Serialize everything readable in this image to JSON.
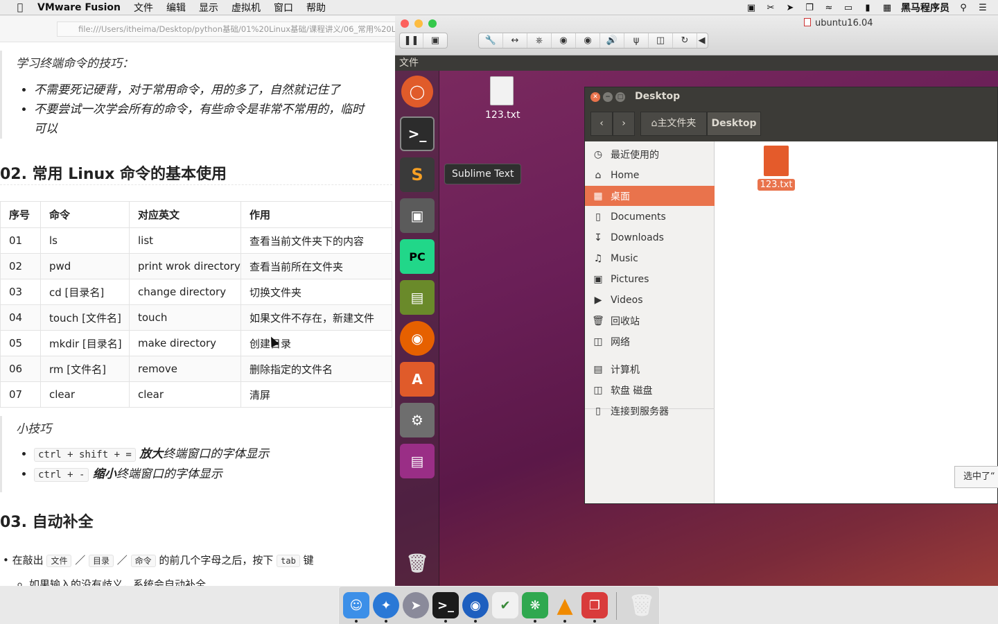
{
  "menubar": {
    "app": "VMware Fusion",
    "items": [
      "文件",
      "编辑",
      "显示",
      "虚拟机",
      "窗口",
      "帮助"
    ],
    "right_user": "黑马程序员"
  },
  "doc": {
    "url": "file:///Users/itheima/Desktop/python基础/01%20Linux基础/课程讲义/06_常用%20L",
    "tips_heading": "学习终端命令的技巧：",
    "tips": [
      "不需要死记硬背，对于常用命令，用的多了，自然就记住了",
      "不要尝试一次学会所有的命令，有些命令是非常不常用的，临时"
    ],
    "tips_cont": "可以",
    "section2": "02. 常用 Linux 命令的基本使用",
    "table": {
      "headers": [
        "序号",
        "命令",
        "对应英文",
        "作用"
      ],
      "rows": [
        [
          "01",
          "ls",
          "list",
          "查看当前文件夹下的内容"
        ],
        [
          "02",
          "pwd",
          "print wrok directory",
          "查看当前所在文件夹"
        ],
        [
          "03",
          "cd [目录名]",
          "change directory",
          "切换文件夹"
        ],
        [
          "04",
          "touch [文件名]",
          "touch",
          "如果文件不存在，新建文件"
        ],
        [
          "05",
          "mkdir [目录名]",
          "make directory",
          "创建目录"
        ],
        [
          "06",
          "rm [文件名]",
          "remove",
          "删除指定的文件名"
        ],
        [
          "07",
          "clear",
          "clear",
          "清屏"
        ]
      ]
    },
    "tricks_heading": "小技巧",
    "tricks": [
      {
        "code": "ctrl + shift + =",
        "bold": "放大",
        "rest": "终端窗口的字体显示"
      },
      {
        "code": "ctrl + -",
        "bold": "缩小",
        "rest": "终端窗口的字体显示"
      }
    ],
    "section3": "03. 自动补全",
    "autocomplete": {
      "pre": "在敲出",
      "c1": "文件",
      "c2": "目录",
      "c3": "命令",
      "mid": "的前几个字母之后，按下",
      "c4": "tab",
      "post": "键"
    },
    "autocomplete_sub": "如果输入的没有歧义，系统会自动补全"
  },
  "vm": {
    "title": "ubuntu16.04",
    "top_bar_label": "文件",
    "launcher_tooltip": "Sublime Text",
    "desktop_file": "123.txt",
    "nautilus": {
      "title": "Desktop",
      "path_home": "主文件夹",
      "path_current": "Desktop",
      "sidebar": [
        "最近使用的",
        "Home",
        "桌面",
        "Documents",
        "Downloads",
        "Music",
        "Pictures",
        "Videos",
        "回收站",
        "网络",
        "计算机",
        "软盘 磁盘",
        "连接到服务器"
      ],
      "file": "123.txt",
      "status": "选中了“"
    }
  }
}
